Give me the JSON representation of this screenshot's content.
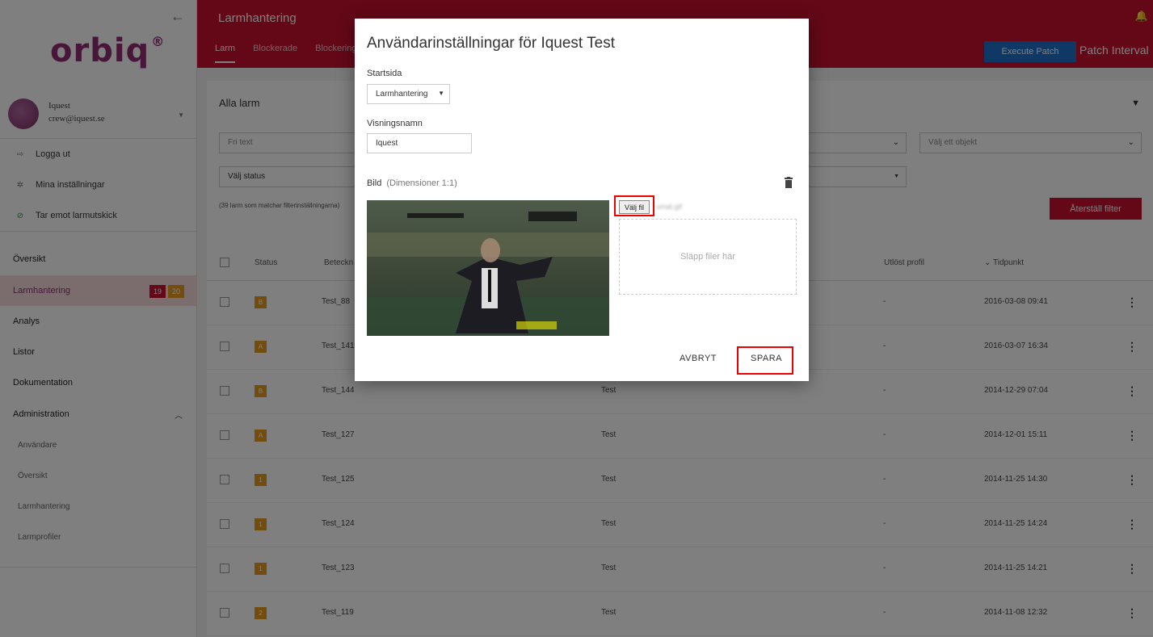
{
  "sidebar": {
    "logo": "orbiq",
    "logo_mark": "®",
    "user": {
      "name": "Iquest",
      "email": "crew@iquest.se"
    },
    "actions": [
      {
        "label": "Logga ut",
        "icon": "logout-icon"
      },
      {
        "label": "Mina inställningar",
        "icon": "gear-icon"
      },
      {
        "label": "Tar emot larmutskick",
        "icon": "check-circle-icon"
      }
    ],
    "nav": [
      {
        "label": "Översikt"
      },
      {
        "label": "Larmhantering"
      },
      {
        "label": "Analys"
      },
      {
        "label": "Listor"
      },
      {
        "label": "Dokumentation"
      },
      {
        "label": "Administration"
      }
    ],
    "badges": {
      "red": "19",
      "orange": "20"
    },
    "sub_nav": [
      {
        "label": "Användare"
      },
      {
        "label": "Översikt"
      },
      {
        "label": "Larmhantering"
      },
      {
        "label": "Larmprofiler"
      }
    ]
  },
  "header": {
    "title": "Larmhantering",
    "tabs": [
      "Larm",
      "Blockerade",
      "Blockering"
    ],
    "execute_patch": "Execute Patch",
    "patch_interval": "Patch Interval"
  },
  "main": {
    "title": "Alla larm",
    "filters": {
      "free_text_placeholder": "Fri text",
      "object_placeholder": "Välj ett objekt",
      "status_placeholder": "Välj status"
    },
    "match_text": "(39 larm som matchar filterinställningarna)",
    "reset_filter": "Återställ filter",
    "columns": {
      "status": "Status",
      "designation": "Beteckn",
      "profile": "Utlöst profil",
      "time": "Tidpunkt"
    },
    "rows": [
      {
        "sev": "B",
        "name": "Test_88",
        "obj": "",
        "profile": "-",
        "time": "2016-03-08 09:41"
      },
      {
        "sev": "A",
        "name": "Test_141",
        "obj": "",
        "profile": "-",
        "time": "2016-03-07 16:34"
      },
      {
        "sev": "B",
        "name": "Test_144",
        "obj": "Test",
        "profile": "-",
        "time": "2014-12-29 07:04"
      },
      {
        "sev": "A",
        "name": "Test_127",
        "obj": "Test",
        "profile": "-",
        "time": "2014-12-01 15:11"
      },
      {
        "sev": "1",
        "name": "Test_125",
        "obj": "Test",
        "profile": "-",
        "time": "2014-11-25 14:30"
      },
      {
        "sev": "1",
        "name": "Test_124",
        "obj": "Test",
        "profile": "-",
        "time": "2014-11-25 14:24"
      },
      {
        "sev": "1",
        "name": "Test_123",
        "obj": "Test",
        "profile": "-",
        "time": "2014-11-25 14:21"
      },
      {
        "sev": "2",
        "name": "Test_119",
        "obj": "Test",
        "profile": "-",
        "time": "2014-11-08 12:32"
      }
    ]
  },
  "modal": {
    "title": "Användarinställningar för Iquest Test",
    "start_page_label": "Startsida",
    "start_page_value": "Larmhantering",
    "display_name_label": "Visningsnamn",
    "display_name_value": "Iquest",
    "image_label": "Bild",
    "image_dimensions": "(Dimensioner 1:1)",
    "choose_file": "Välj fil",
    "filename": "umat.gif",
    "drop_text": "Släpp filer här",
    "cancel": "AVBRYT",
    "save": "SPARA"
  },
  "colors": {
    "brand_red": "#c8102e",
    "brand_purple": "#8e2c73",
    "execute_blue": "#1e73c8",
    "severity_orange": "#e59a1c",
    "highlight_red": "#ee0000"
  }
}
